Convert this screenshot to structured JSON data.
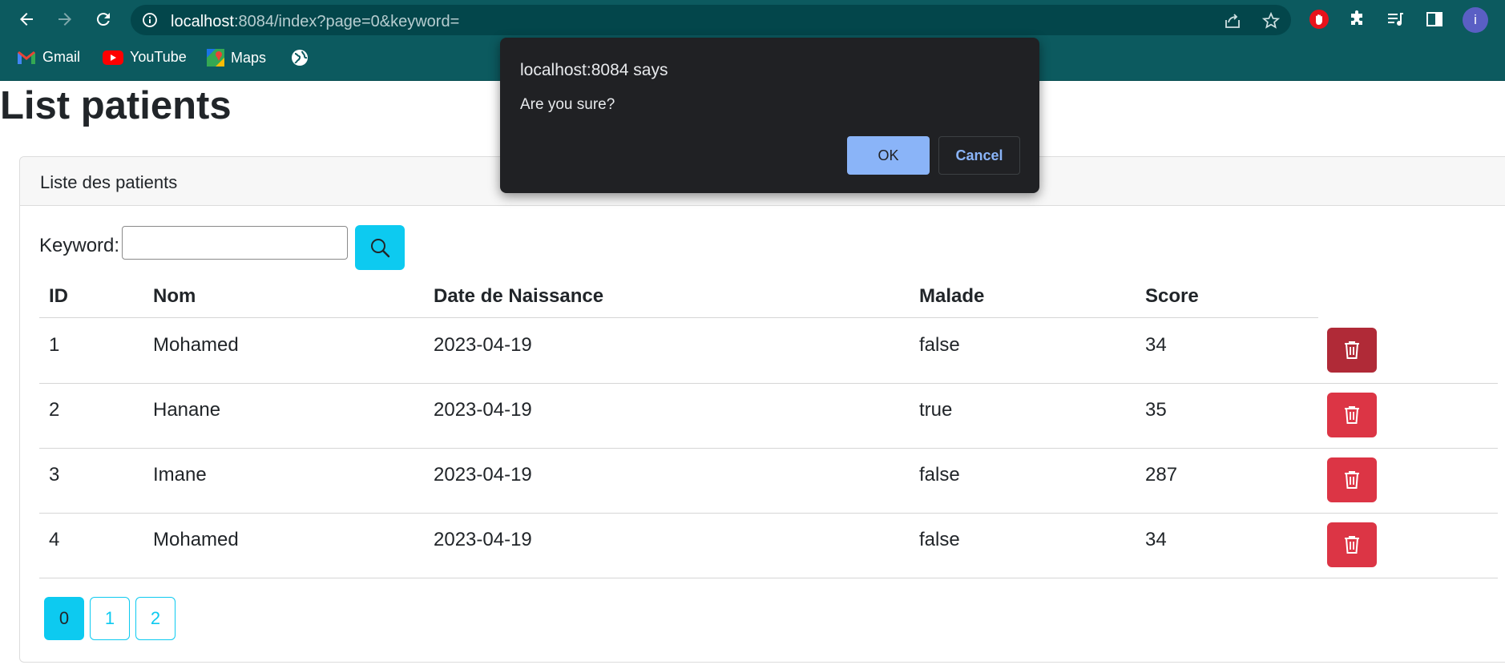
{
  "browser": {
    "url_host": "localhost",
    "url_path": ":8084/index?page=0&keyword=",
    "avatar_letter": "i",
    "bookmarks": [
      {
        "label": "Gmail",
        "icon": "gmail-icon"
      },
      {
        "label": "YouTube",
        "icon": "youtube-icon"
      },
      {
        "label": "Maps",
        "icon": "maps-icon"
      }
    ]
  },
  "page": {
    "title": "List patients",
    "card_title": "Liste des patients",
    "keyword_label": "Keyword:",
    "keyword_value": ""
  },
  "table": {
    "headers": [
      "ID",
      "Nom",
      "Date de Naissance",
      "Malade",
      "Score"
    ],
    "rows": [
      {
        "id": "1",
        "nom": "Mohamed",
        "date": "2023-04-19",
        "malade": "false",
        "score": "34"
      },
      {
        "id": "2",
        "nom": "Hanane",
        "date": "2023-04-19",
        "malade": "true",
        "score": "35"
      },
      {
        "id": "3",
        "nom": "Imane",
        "date": "2023-04-19",
        "malade": "false",
        "score": "287"
      },
      {
        "id": "4",
        "nom": "Mohamed",
        "date": "2023-04-19",
        "malade": "false",
        "score": "34"
      }
    ]
  },
  "pagination": {
    "pages": [
      "0",
      "1",
      "2"
    ],
    "current": "0"
  },
  "dialog": {
    "title": "localhost:8084 says",
    "message": "Are you sure?",
    "ok_label": "OK",
    "cancel_label": "Cancel"
  },
  "colors": {
    "chrome": "#0c5a5f",
    "info_button": "#0dcaf0",
    "danger": "#dc3545",
    "dialog_bg": "#202124",
    "dialog_accent": "#8ab4f8"
  }
}
